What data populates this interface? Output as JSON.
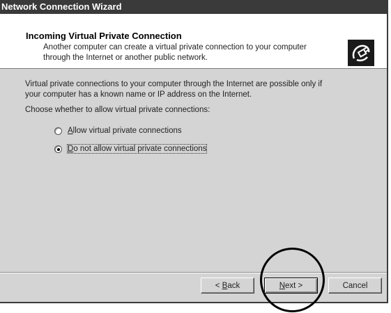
{
  "window": {
    "title": "Network Connection Wizard"
  },
  "header": {
    "title": "Incoming Virtual Private Connection",
    "subtitle_line1": "Another computer can create a virtual private connection to your computer",
    "subtitle_line2": "through the Internet or another public network.",
    "icon": "network-plug-icon"
  },
  "content": {
    "description_line1": "Virtual private connections to your computer through the Internet are possible only if",
    "description_line2": "your computer has a known name or IP address on the Internet.",
    "prompt": "Choose whether to allow virtual private connections:",
    "options": [
      {
        "accel": "A",
        "label_rest": "llow virtual private connections",
        "checked": false
      },
      {
        "accel": "D",
        "label_rest": "o not allow virtual private connections",
        "checked": true
      }
    ]
  },
  "buttons": {
    "back_prefix": "< ",
    "back_accel": "B",
    "back_rest": "ack",
    "next_accel": "N",
    "next_rest": "ext >",
    "cancel": "Cancel"
  },
  "colors": {
    "titlebar": "#3a3a3a",
    "face": "#d4d4d4",
    "header_bg": "#ffffff"
  }
}
